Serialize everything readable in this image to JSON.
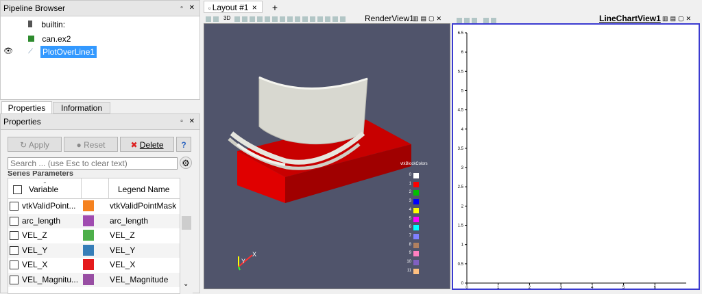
{
  "pipeline": {
    "title": "Pipeline Browser",
    "items": [
      {
        "label": "builtin:"
      },
      {
        "label": "can.ex2"
      },
      {
        "label": "PlotOverLine1"
      }
    ]
  },
  "tabs": {
    "properties": "Properties",
    "information": "Information"
  },
  "properties_panel": {
    "title": "Properties",
    "apply": "Apply",
    "reset": "Reset",
    "delete": "Delete",
    "help": "?",
    "search_placeholder": "Search ... (use Esc to clear text)",
    "section": "Series Parameters",
    "col_variable": "Variable",
    "col_legend": "Legend Name",
    "series": [
      {
        "var": "vtkValidPoint...",
        "legend": "vtkValidPointMask",
        "color": "#f58220"
      },
      {
        "var": "arc_length",
        "legend": "arc_length",
        "color": "#a04cb0"
      },
      {
        "var": "VEL_Z",
        "legend": "VEL_Z",
        "color": "#4daf4a"
      },
      {
        "var": "VEL_Y",
        "legend": "VEL_Y",
        "color": "#377eb8"
      },
      {
        "var": "VEL_X",
        "legend": "VEL_X",
        "color": "#e41a1c"
      },
      {
        "var": "VEL_Magnitu...",
        "legend": "VEL_Magnitude",
        "color": "#984ea3"
      }
    ]
  },
  "layout": {
    "tab": "Layout #1",
    "close": "×",
    "add": "+"
  },
  "render_view": {
    "title": "RenderView1",
    "toolbar_3d": "3D",
    "legend_title": "vtkBlockColors",
    "legend": [
      {
        "label": "0",
        "color": "#ffffff"
      },
      {
        "label": "1",
        "color": "#ff0000"
      },
      {
        "label": "2",
        "color": "#00c000"
      },
      {
        "label": "3",
        "color": "#0000ff"
      },
      {
        "label": "4",
        "color": "#ffff00"
      },
      {
        "label": "5",
        "color": "#ff00ff"
      },
      {
        "label": "6",
        "color": "#00ffff"
      },
      {
        "label": "7",
        "color": "#8080ff"
      },
      {
        "label": "8",
        "color": "#b08060"
      },
      {
        "label": "9",
        "color": "#ff80c0"
      },
      {
        "label": "10",
        "color": "#8060c0"
      },
      {
        "label": "11",
        "color": "#ffc080"
      }
    ],
    "axis_x": "X",
    "axis_y": "Y"
  },
  "chart_view": {
    "title": "LineChartView1"
  },
  "chart_data": {
    "type": "line",
    "title": "",
    "xlabel": "",
    "ylabel": "",
    "xlim": [
      0,
      7
    ],
    "ylim": [
      0,
      6.5
    ],
    "x_ticks": [
      "0",
      "1",
      "2",
      "3",
      "4",
      "5",
      "6"
    ],
    "y_ticks": [
      "0",
      "0.5",
      "1",
      "1.5",
      "2",
      "2.5",
      "3",
      "3.5",
      "4",
      "4.5",
      "5",
      "5.5",
      "6",
      "6.5"
    ],
    "series": []
  }
}
